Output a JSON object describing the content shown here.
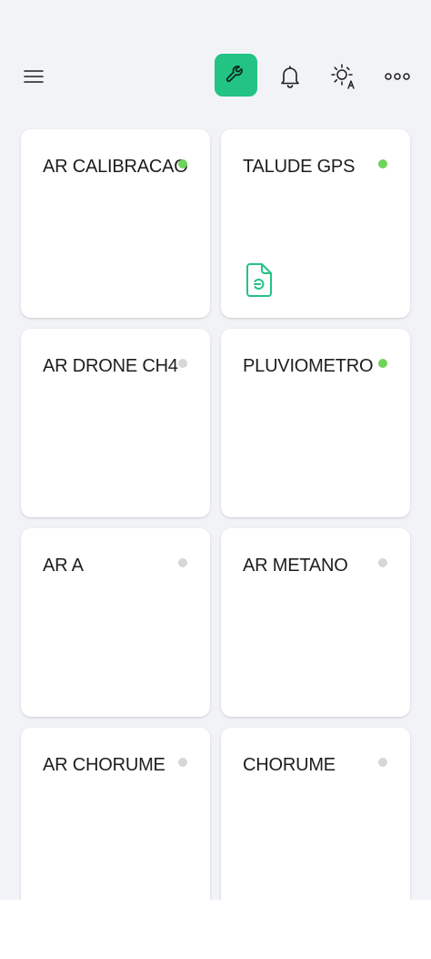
{
  "header": {
    "menu_icon": "hamburger-menu-icon",
    "tool_icon": "wrench-icon",
    "bell_icon": "bell-icon",
    "theme_icon": "auto-brightness-icon",
    "more_icon": "more-horizontal-icon"
  },
  "colors": {
    "accent": "#22c383",
    "online": "#6fd45a",
    "offline": "#d7d7d9"
  },
  "cards": [
    {
      "title": "AR CALIBRACAO",
      "status": "online"
    },
    {
      "title": "TALUDE GPS",
      "status": "online",
      "icon": "document-icon"
    },
    {
      "title": "AR DRONE CH4",
      "status": "offline"
    },
    {
      "title": "PLUVIOMETRO",
      "status": "online"
    },
    {
      "title": "AR A",
      "status": "offline"
    },
    {
      "title": "AR METANO",
      "status": "offline"
    },
    {
      "title": "AR CHORUME",
      "status": "offline"
    },
    {
      "title": "CHORUME",
      "status": "offline"
    }
  ]
}
